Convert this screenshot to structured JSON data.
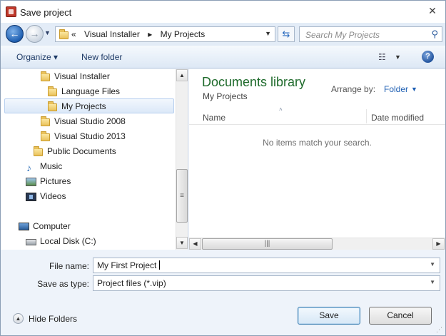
{
  "window": {
    "title": "Save project"
  },
  "address": {
    "prefix": "«",
    "crumbs": [
      "Visual Installer",
      "▸",
      "My Projects"
    ]
  },
  "search": {
    "placeholder": "Search My Projects"
  },
  "toolbar": {
    "organize": "Organize ▾",
    "new_folder": "New folder"
  },
  "tree": [
    {
      "label": "Visual Installer",
      "icon": "folder-icon",
      "indent": 1
    },
    {
      "label": "Language Files",
      "icon": "folder-icon",
      "indent": 2
    },
    {
      "label": "My Projects",
      "icon": "folder-icon",
      "indent": 2,
      "selected": true
    },
    {
      "label": "Visual Studio 2008",
      "icon": "folder-icon",
      "indent": 1
    },
    {
      "label": "Visual Studio 2013",
      "icon": "folder-icon",
      "indent": 1
    },
    {
      "label": "Public Documents",
      "icon": "folder-icon",
      "indent": 0
    },
    {
      "label": "Music",
      "icon": "music-icon",
      "indent": -1
    },
    {
      "label": "Pictures",
      "icon": "pictures-icon",
      "indent": -1
    },
    {
      "label": "Videos",
      "icon": "videos-icon",
      "indent": -1
    },
    {
      "label": "Computer",
      "icon": "computer-icon",
      "indent": -2
    },
    {
      "label": "Local Disk (C:)",
      "icon": "disk-icon",
      "indent": -1
    }
  ],
  "library": {
    "title": "Documents library",
    "subtitle": "My Projects",
    "arrange_label": "Arrange by:",
    "arrange_value": "Folder"
  },
  "columns": {
    "name": "Name",
    "date_modified": "Date modified"
  },
  "empty_message": "No items match your search.",
  "fields": {
    "file_name_label": "File name:",
    "file_name_value": "My First Project",
    "save_type_label": "Save as type:",
    "save_type_value": "Project files (*.vip)"
  },
  "footer": {
    "hide_folders": "Hide Folders",
    "save": "Save",
    "cancel": "Cancel"
  }
}
